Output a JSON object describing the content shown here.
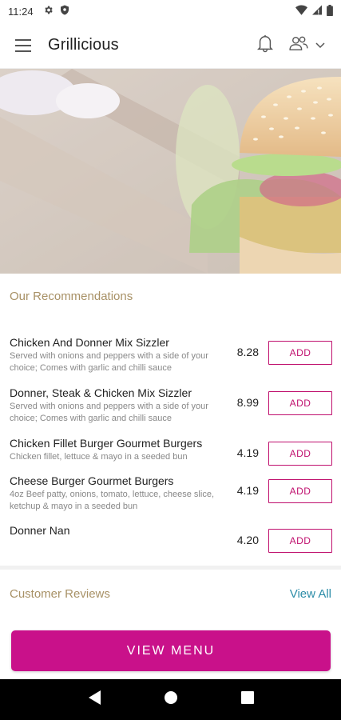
{
  "status_bar": {
    "time": "11:24"
  },
  "app_bar": {
    "title": "Grillicious"
  },
  "recommendations": {
    "title": "Our Recommendations",
    "items": [
      {
        "name": "Chicken And Donner Mix Sizzler",
        "desc": "Served with onions and peppers with a side of your choice; Comes with garlic and chilli sauce",
        "price": "8.28",
        "button": "ADD"
      },
      {
        "name": "Donner, Steak & Chicken Mix Sizzler",
        "desc": "Served with onions and peppers with a side of your choice; Comes with garlic and chilli sauce",
        "price": "8.99",
        "button": "ADD"
      },
      {
        "name": "Chicken Fillet Burger Gourmet Burgers",
        "desc": "Chicken fillet, lettuce & mayo in a seeded bun",
        "price": "4.19",
        "button": "ADD"
      },
      {
        "name": "Cheese Burger Gourmet Burgers",
        "desc": "4oz Beef patty, onions, tomato, lettuce, cheese slice, ketchup & mayo in a seeded bun",
        "price": "4.19",
        "button": "ADD"
      },
      {
        "name": "Donner Nan",
        "desc": "",
        "price": "4.20",
        "button": "ADD"
      }
    ]
  },
  "reviews": {
    "title": "Customer Reviews",
    "view_all": "View All"
  },
  "cta": {
    "label": "VIEW MENU"
  },
  "colors": {
    "accent": "#c9118a",
    "section_title": "#a89166",
    "link": "#2d8da8"
  }
}
